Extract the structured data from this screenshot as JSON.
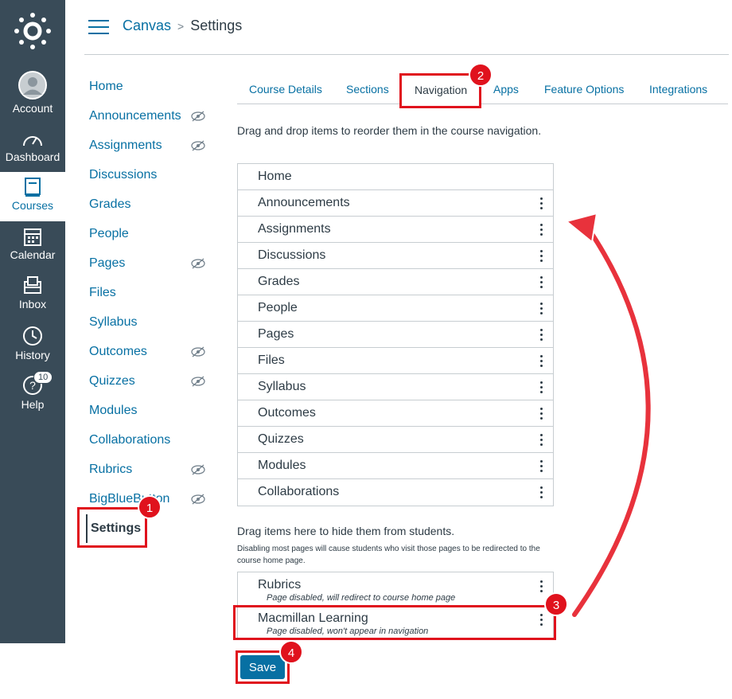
{
  "global_nav": {
    "items": [
      {
        "label": "Account",
        "icon": "account-icon"
      },
      {
        "label": "Dashboard",
        "icon": "dashboard-icon"
      },
      {
        "label": "Courses",
        "icon": "courses-icon"
      },
      {
        "label": "Calendar",
        "icon": "calendar-icon"
      },
      {
        "label": "Inbox",
        "icon": "inbox-icon"
      },
      {
        "label": "History",
        "icon": "history-icon"
      },
      {
        "label": "Help",
        "icon": "help-icon",
        "badge": "10"
      }
    ],
    "active": "Courses"
  },
  "header": {
    "breadcrumb_root": "Canvas",
    "breadcrumb_separator": ">",
    "breadcrumb_current": "Settings"
  },
  "course_nav": {
    "items": [
      {
        "label": "Home",
        "hidden": false
      },
      {
        "label": "Announcements",
        "hidden": true
      },
      {
        "label": "Assignments",
        "hidden": true
      },
      {
        "label": "Discussions",
        "hidden": false
      },
      {
        "label": "Grades",
        "hidden": false
      },
      {
        "label": "People",
        "hidden": false
      },
      {
        "label": "Pages",
        "hidden": true
      },
      {
        "label": "Files",
        "hidden": false
      },
      {
        "label": "Syllabus",
        "hidden": false
      },
      {
        "label": "Outcomes",
        "hidden": true
      },
      {
        "label": "Quizzes",
        "hidden": true
      },
      {
        "label": "Modules",
        "hidden": false
      },
      {
        "label": "Collaborations",
        "hidden": false
      },
      {
        "label": "Rubrics",
        "hidden": true
      },
      {
        "label": "BigBlueButton",
        "hidden": true
      }
    ],
    "active_label": "Settings"
  },
  "tabs": {
    "items": [
      "Course Details",
      "Sections",
      "Navigation",
      "Apps",
      "Feature Options",
      "Integrations"
    ],
    "active": "Navigation"
  },
  "instructions": "Drag and drop items to reorder them in the course navigation.",
  "enabled_items": [
    "Home",
    "Announcements",
    "Assignments",
    "Discussions",
    "Grades",
    "People",
    "Pages",
    "Files",
    "Syllabus",
    "Outcomes",
    "Quizzes",
    "Modules",
    "Collaborations"
  ],
  "hidden_section": {
    "heading": "Drag items here to hide them from students.",
    "subtext": "Disabling most pages will cause students who visit those pages to be redirected to the course home page.",
    "items": [
      {
        "name": "Rubrics",
        "note": "Page disabled, will redirect to course home page"
      },
      {
        "name": "Macmillan Learning",
        "note": "Page disabled, won't appear in navigation"
      }
    ]
  },
  "save_label": "Save",
  "steps": [
    "1",
    "2",
    "3",
    "4"
  ],
  "colors": {
    "nav_bg": "#394b58",
    "link": "#0770a3",
    "highlight": "#e0121d",
    "text": "#2d3b45"
  }
}
